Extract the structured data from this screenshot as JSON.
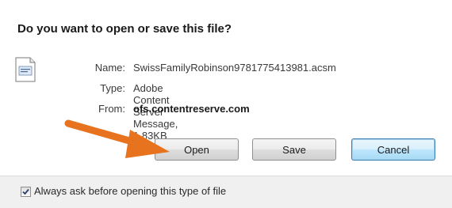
{
  "dialog": {
    "title": "Do you want to open or save this file?",
    "file_icon": "document-icon",
    "details": {
      "name_label": "Name:",
      "name_value": "SwissFamilyRobinson9781775413981.acsm",
      "type_label": "Type:",
      "type_value": "Adobe Content Server Message, 1.83KB",
      "from_label": "From:",
      "from_value": "ofs.contentreserve.com"
    },
    "buttons": {
      "open": "Open",
      "save": "Save",
      "cancel": "Cancel"
    },
    "checkbox": {
      "label": "Always ask before opening this type of file",
      "checked": true
    }
  },
  "annotation": {
    "arrow_color": "#e8731f",
    "arrow_icon": "arrow-right-icon"
  },
  "colors": {
    "cancel_border": "#3c7fb1",
    "footer_bg": "#f0f0f0"
  }
}
